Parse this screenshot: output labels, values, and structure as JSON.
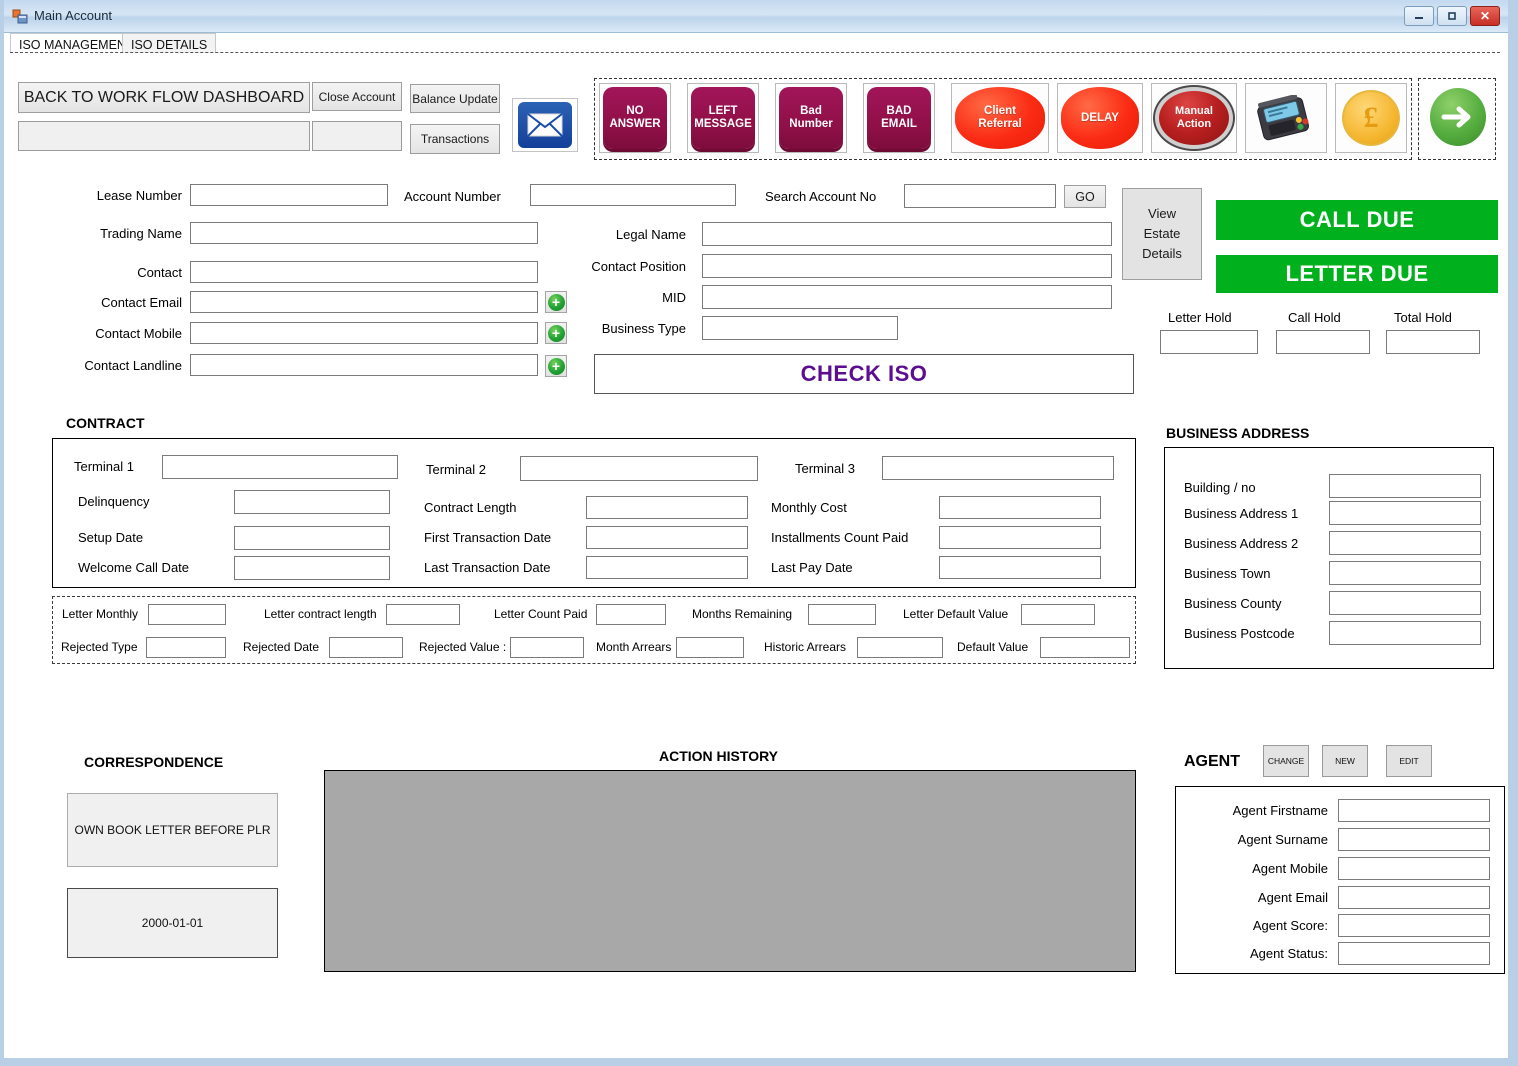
{
  "window": {
    "title": "Main Account",
    "icon": "form-icon",
    "controls": {
      "minimize": "–",
      "maximize": "□",
      "close": "✕"
    }
  },
  "tabs": [
    {
      "label": "ISO MANAGEMENT",
      "active": true
    },
    {
      "label": "ISO DETAILS",
      "active": false
    }
  ],
  "toolbar": {
    "back_dashboard": "BACK TO WORK FLOW DASHBOARD",
    "back_dashboard_value": "",
    "close_account": "Close Account",
    "close_account_value": "",
    "balance_update": "Balance Update",
    "transactions": "Transactions",
    "mail_icon": "envelope-icon"
  },
  "actions": [
    {
      "name": "no-answer",
      "label": "NO\nANSWER",
      "style": "maroon",
      "line1": "NO",
      "line2": "ANSWER"
    },
    {
      "name": "left-message",
      "label": "LEFT\nMESSAGE",
      "style": "maroon",
      "line1": "LEFT",
      "line2": "MESSAGE"
    },
    {
      "name": "bad-number",
      "label": "Bad\nNumber",
      "style": "maroon",
      "line1": "Bad",
      "line2": "Number"
    },
    {
      "name": "bad-email",
      "label": "BAD\nEMAIL",
      "style": "maroon",
      "line1": "BAD",
      "line2": "EMAIL"
    },
    {
      "name": "client-referral",
      "label": "Client\nReferral",
      "style": "red",
      "line1": "Client",
      "line2": "Referral"
    },
    {
      "name": "delay",
      "label": "DELAY",
      "style": "red",
      "line1": "DELAY",
      "line2": ""
    },
    {
      "name": "manual-action",
      "label": "Manual\nAction",
      "style": "manual",
      "line1": "Manual",
      "line2": "Action"
    }
  ],
  "icon_actions": [
    {
      "name": "card-terminal-icon",
      "label": "card-terminal-icon"
    },
    {
      "name": "pound-coin-icon",
      "label": "£"
    },
    {
      "name": "next-arrow-icon",
      "label": "→"
    }
  ],
  "account": {
    "lease_number_label": "Lease Number",
    "lease_number_value": "",
    "account_number_label": "Account Number",
    "account_number_value": "",
    "search_account_label": "Search Account No",
    "search_account_value": "",
    "go_label": "GO",
    "view_estate_details": "View\nEstate\nDetails",
    "view_estate_line1": "View",
    "view_estate_line2": "Estate",
    "view_estate_line3": "Details",
    "trading_name_label": "Trading Name",
    "trading_name_value": "",
    "legal_name_label": "Legal Name",
    "legal_name_value": "",
    "contact_label": "Contact",
    "contact_value": "",
    "contact_position_label": "Contact Position",
    "contact_position_value": "",
    "contact_email_label": "Contact Email",
    "contact_email_value": "",
    "mid_label": "MID",
    "mid_value": "",
    "contact_mobile_label": "Contact Mobile",
    "contact_mobile_value": "",
    "business_type_label": "Business Type",
    "business_type_value": "",
    "contact_landline_label": "Contact Landline",
    "contact_landline_value": "",
    "check_iso_label": "CHECK ISO",
    "add_icon": "plus-circle-icon"
  },
  "status": {
    "call_due": "CALL DUE",
    "letter_due": "LETTER DUE",
    "call_due_color": "#00b01d",
    "letter_due_color": "#00b01d",
    "letter_hold_label": "Letter Hold",
    "letter_hold_value": "",
    "call_hold_label": "Call Hold",
    "call_hold_value": "",
    "total_hold_label": "Total Hold",
    "total_hold_value": ""
  },
  "contract": {
    "title": "CONTRACT",
    "terminal1_label": "Terminal 1",
    "terminal1_value": "",
    "terminal2_label": "Terminal 2",
    "terminal2_value": "",
    "terminal3_label": "Terminal 3",
    "terminal3_value": "",
    "delinquency_label": "Delinquency",
    "delinquency_value": "",
    "contract_length_label": "Contract Length",
    "contract_length_value": "",
    "monthly_cost_label": "Monthly Cost",
    "monthly_cost_value": "",
    "setup_date_label": "Setup Date",
    "setup_date_value": "",
    "first_transaction_date_label": "First Transaction Date",
    "first_transaction_date_value": "",
    "installments_count_paid_label": "Installments Count Paid",
    "installments_count_paid_value": "",
    "welcome_call_date_label": "Welcome Call Date",
    "welcome_call_date_value": "",
    "last_transaction_date_label": "Last Transaction Date",
    "last_transaction_date_value": "",
    "last_pay_date_label": "Last Pay Date",
    "last_pay_date_value": ""
  },
  "letter_panel": {
    "letter_monthly_label": "Letter Monthly",
    "letter_monthly_value": "",
    "letter_contract_length_label": "Letter contract length",
    "letter_contract_length_value": "",
    "letter_count_paid_label": "Letter Count Paid",
    "letter_count_paid_value": "",
    "months_remaining_label": "Months Remaining",
    "months_remaining_value": "",
    "letter_default_value_label": "Letter Default Value",
    "letter_default_value_value": "",
    "rejected_type_label": "Rejected Type",
    "rejected_type_value": "",
    "rejected_date_label": "Rejected Date",
    "rejected_date_value": "",
    "rejected_value_label": "Rejected Value :",
    "rejected_value_value": "",
    "month_arrears_label": "Month Arrears",
    "month_arrears_value": "",
    "historic_arrears_label": "Historic Arrears",
    "historic_arrears_value": "",
    "default_value_label": "Default Value",
    "default_value_value": ""
  },
  "business_address": {
    "title": "BUSINESS ADDRESS",
    "rows": [
      {
        "label": "Building / no",
        "value": ""
      },
      {
        "label": "Business Address 1",
        "value": ""
      },
      {
        "label": "Business Address 2",
        "value": ""
      },
      {
        "label": "Business Town",
        "value": ""
      },
      {
        "label": "Business County",
        "value": ""
      },
      {
        "label": "Business Postcode",
        "value": ""
      }
    ]
  },
  "correspondence": {
    "title": "CORRESPONDENCE",
    "letter_type": "OWN BOOK LETTER BEFORE PLR",
    "letter_date": "2000-01-01"
  },
  "action_history": {
    "title": "ACTION HISTORY",
    "rows": []
  },
  "agent": {
    "title": "AGENT",
    "change_label": "CHANGE",
    "new_label": "NEW",
    "edit_label": "EDIT",
    "rows": [
      {
        "label": "Agent Firstname",
        "value": ""
      },
      {
        "label": "Agent Surname",
        "value": ""
      },
      {
        "label": "Agent Mobile",
        "value": ""
      },
      {
        "label": "Agent Email",
        "value": ""
      },
      {
        "label": "Agent Score:",
        "value": ""
      },
      {
        "label": "Agent Status:",
        "value": ""
      }
    ]
  }
}
